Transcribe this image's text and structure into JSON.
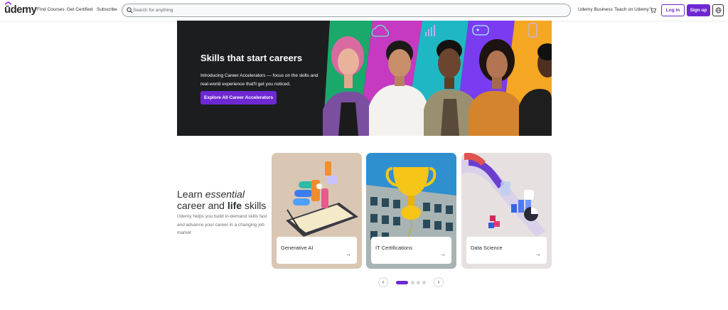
{
  "header": {
    "logo": "ūdemy",
    "nav": [
      "Find Courses",
      "Get Certified",
      "Subscribe"
    ],
    "search_placeholder": "Search for anything",
    "business": "Udemy Business",
    "teach": "Teach on Udemy",
    "login": "Log in",
    "signup": "Sign up"
  },
  "hero": {
    "title": "Skills that start careers",
    "description": "Introducing Career Accelerators — focus on the skills and real-world experience that'll get you noticed.",
    "button": "Explore All Career Accelerators"
  },
  "learn": {
    "title_part1": "Learn",
    "title_em": "essential",
    "title_part2": "career and",
    "title_bold": "life",
    "title_part3": "skills",
    "description": "Udemy helps you build in-demand skills fast and advance your career in a changing job market"
  },
  "cards": [
    {
      "label": "Generative AI"
    },
    {
      "label": "IT Certifications"
    },
    {
      "label": "Data Science"
    }
  ],
  "carousel": {
    "prev": "‹",
    "next": "›",
    "active_index": 0,
    "count": 4
  },
  "colors": {
    "brand": "#6d28d2",
    "dark": "#1c1d1f",
    "text": "#2d2f31"
  }
}
